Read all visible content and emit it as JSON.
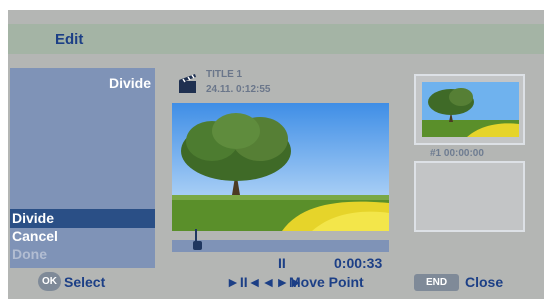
{
  "title": "Edit",
  "left_panel": {
    "heading": "Divide",
    "menu": [
      {
        "label": "Divide",
        "state": "selected"
      },
      {
        "label": "Cancel",
        "state": "normal"
      },
      {
        "label": "Done",
        "state": "disabled"
      }
    ]
  },
  "info": {
    "icon": "clapperboard-icon",
    "title": "TITLE 1",
    "datetime": "24.11.  0:12:55"
  },
  "playback": {
    "status_symbol": "II",
    "time": "0:00:33",
    "move_controls": "►II◄◄►►",
    "move_label": "Move Point"
  },
  "thumbnail": {
    "label": "#1    00:00:00"
  },
  "footer": {
    "ok_icon": "OK",
    "select_label": "Select",
    "end_icon": "END",
    "close_label": "Close"
  },
  "colors": {
    "menu_selected": "#2a4f86",
    "panel_bg": "#7f93b7",
    "text_blue": "#1c3f86",
    "screen_bg": "#b4b6b4"
  }
}
